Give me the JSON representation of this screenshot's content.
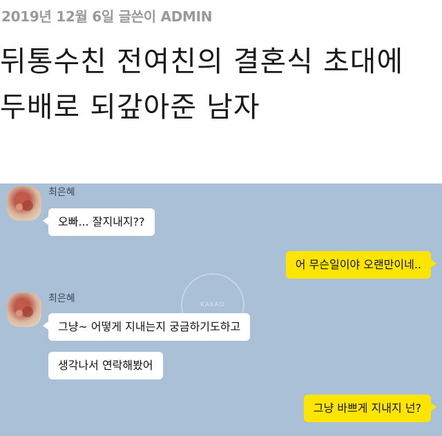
{
  "post": {
    "meta": "2019년 12월 6일 글쓴이 ADMIN",
    "title": "뒤통수친 전여친의 결혼식 초대에 두배로 되갚아준 남자"
  },
  "chat": {
    "watermark": "KAKAO",
    "messages": [
      {
        "sender": "최은혜",
        "text": "오빠... 잘지내지??"
      },
      {
        "sender": "me",
        "text": "어 무슨일이야 오랜만이네.."
      },
      {
        "sender": "최은혜",
        "text": "그냥~ 어떻게 지내는지 궁금하기도하고"
      },
      {
        "sender": "최은혜",
        "text": "생각나서 연락해봤어"
      },
      {
        "sender": "me",
        "text": "그냥 바쁘게 지내지 넌?"
      }
    ]
  },
  "colors": {
    "chat_background": "#a9c0d7",
    "incoming_bubble": "#ffffff",
    "outgoing_bubble": "#fee500",
    "meta_text": "#9a9a9a",
    "title_text": "#1a1a1a"
  }
}
